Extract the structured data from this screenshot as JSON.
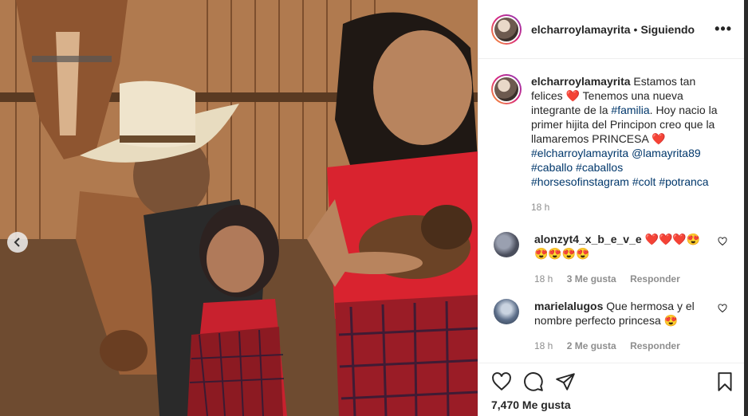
{
  "post": {
    "username": "elcharroylamayrita",
    "follow_status": "Siguiendo",
    "more_glyph": "•••",
    "caption": {
      "username": "elcharroylamayrita",
      "text1": "Estamos tan felices",
      "heart1": "❤️",
      "text2": "Tenemos una nueva integrante de la",
      "tag_familia": "#familia",
      "text3": ". Hoy nacio la primer hijita del Principon creo que la llamaremos PRINCESA",
      "heart2": "❤️",
      "tag1": "#elcharroylamayrita",
      "mention": "@lamayrita89",
      "tag2": "#caballo",
      "tag3": "#caballos",
      "tag4": "#horsesofinstagram",
      "tag5": "#colt",
      "tag6": "#potranca",
      "time": "18 h"
    },
    "comments": [
      {
        "username": "alonzyt4_x_b_e_v_e",
        "text": "❤️❤️❤️😍 😍😍😍😍",
        "time": "18 h",
        "likes": "3 Me gusta",
        "reply": "Responder",
        "avatar_color": "#6a6f80"
      },
      {
        "username": "marielalugos",
        "text": "Que hermosa y el nombre perfecto princesa 😍",
        "time": "18 h",
        "likes": "2 Me gusta",
        "reply": "Responder",
        "avatar_color": "#7b8fa8"
      }
    ],
    "likes_count": "7,470 Me gusta"
  },
  "icons": {
    "like": "heart-outline-icon",
    "comment": "comment-bubble-icon",
    "share": "paper-plane-icon",
    "save": "bookmark-icon",
    "prev": "chevron-left-icon"
  }
}
